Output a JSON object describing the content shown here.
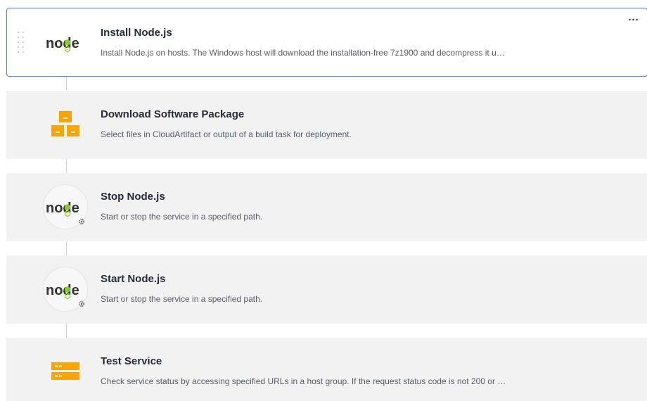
{
  "steps": [
    {
      "title": "Install Node.js",
      "description": "Install Node.js on hosts. The Windows host will download the installation-free 7z1900 and decompress it u…",
      "icon": "nodejs-logo-icon",
      "selected": true
    },
    {
      "title": "Download Software Package",
      "description": "Select files in CloudArtifact or output of a build task for deployment.",
      "icon": "package-boxes-icon",
      "selected": false
    },
    {
      "title": "Stop Node.js",
      "description": "Start or stop the service in a specified path.",
      "icon": "nodejs-service-icon",
      "selected": false
    },
    {
      "title": "Start Node.js",
      "description": "Start or stop the service in a specified path.",
      "icon": "nodejs-service-icon",
      "selected": false
    },
    {
      "title": "Test Service",
      "description": "Check service status by accessing specified URLs in a host group. If the request status code is not 200 or …",
      "icon": "server-test-icon",
      "selected": false
    }
  ],
  "more_label": "···",
  "logo_text": "node",
  "colors": {
    "selected_border": "#5e7ce0",
    "card_bg": "#f2f2f2",
    "node_green": "#83cd29",
    "node_dark": "#333333",
    "package_orange": "#f8a500",
    "connector": "#d9d9d9"
  }
}
